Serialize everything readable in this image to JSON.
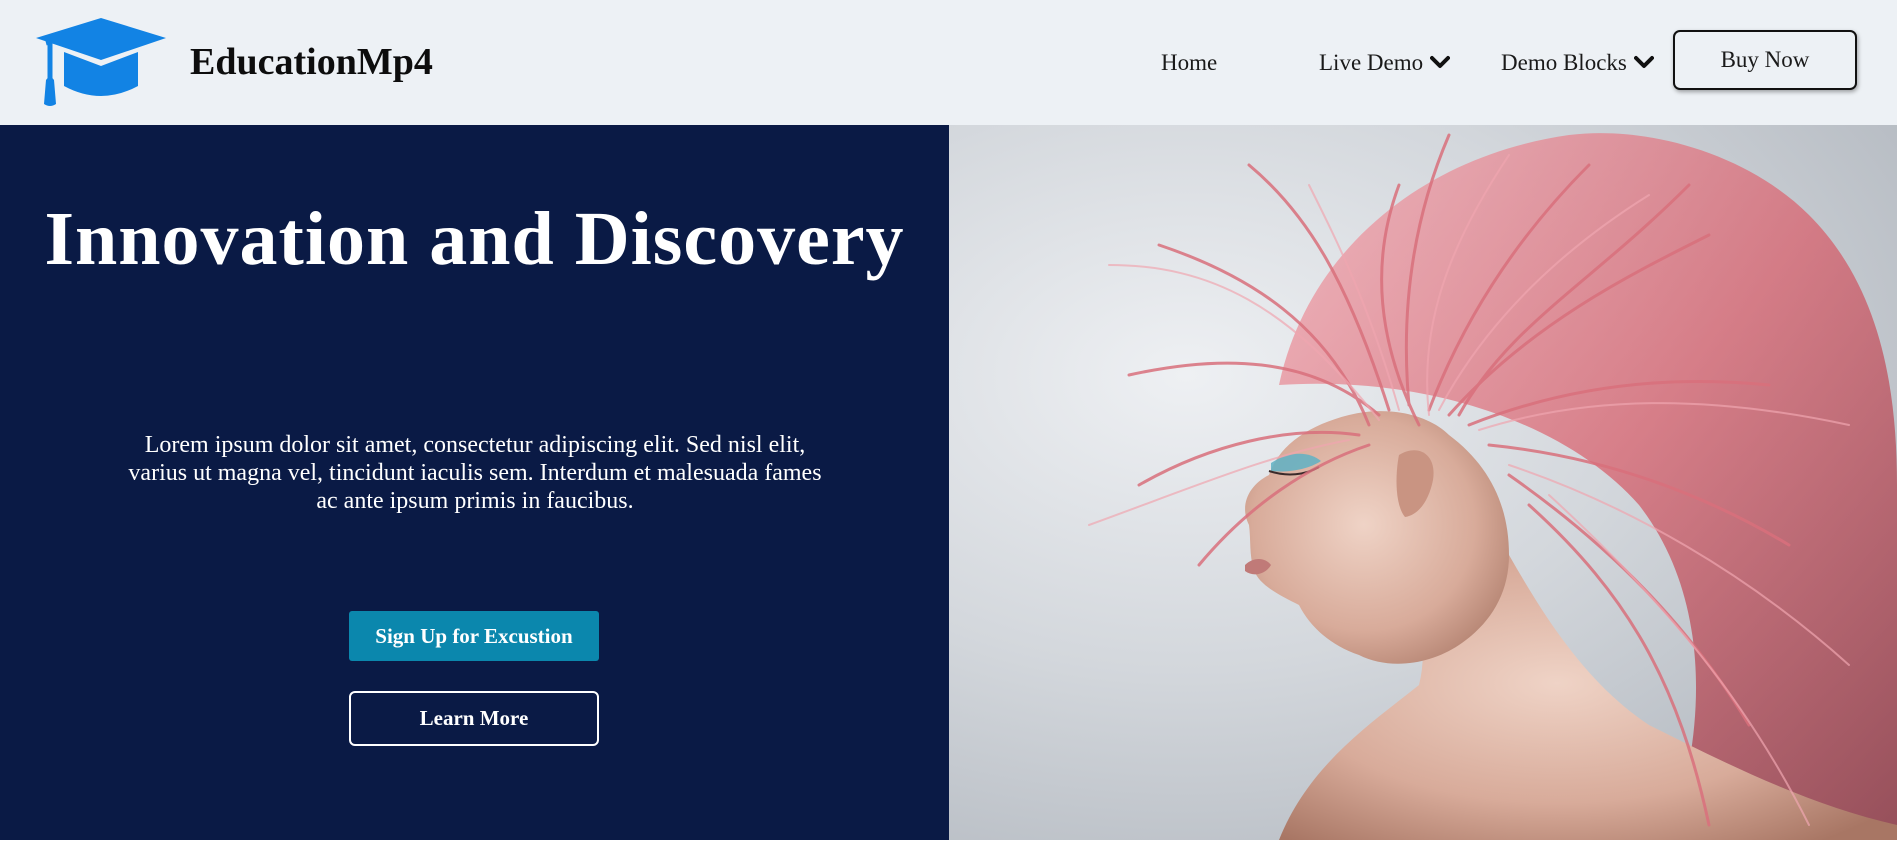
{
  "brand": {
    "name": "EducationMp4",
    "logo_icon": "graduation-cap-icon",
    "logo_color": "#1283e4"
  },
  "nav": {
    "home": "Home",
    "live_demo": "Live Demo",
    "demo_blocks": "Demo Blocks",
    "dropdown_icon": "chevron-down-icon",
    "buy_now": "Buy Now"
  },
  "hero": {
    "title": "Innovation and Discovery",
    "description": "Lorem ipsum dolor sit amet, consectetur adipiscing elit. Sed nisl elit, varius ut magna vel, tincidunt iaculis sem. Interdum et malesuada fames ac ante ipsum primis in faucibus.",
    "primary_button": "Sign Up for Excustion",
    "secondary_button": "Learn More",
    "image": "woman-with-flying-pink-hair-photo"
  },
  "colors": {
    "header_bg": "#edf1f5",
    "hero_bg": "#0a1a45",
    "primary_button_bg": "#0b87ad",
    "text_light": "#ffffff"
  }
}
